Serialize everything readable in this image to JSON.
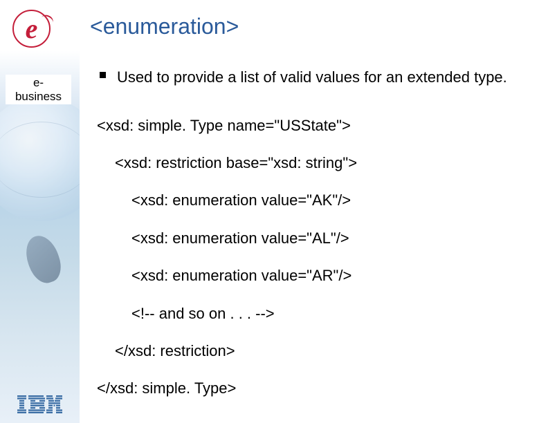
{
  "logo": {
    "e_char": "e",
    "ebusiness_line1": "e-",
    "ebusiness_line2": "business",
    "ibm_alt": "IBM"
  },
  "slide": {
    "title": "<enumeration>",
    "bullet": "Used to provide a list of valid values for an extended type.",
    "code": {
      "l1": "<xsd: simple. Type name=\"USState\">",
      "l2": "<xsd: restriction base=\"xsd: string\">",
      "l3": "<xsd: enumeration value=\"AK\"/>",
      "l4": "<xsd: enumeration value=\"AL\"/>",
      "l5": "<xsd: enumeration value=\"AR\"/>",
      "l6": "<!-- and so on . . . -->",
      "l7": "</xsd: restriction>",
      "l8": "</xsd: simple. Type>"
    }
  }
}
